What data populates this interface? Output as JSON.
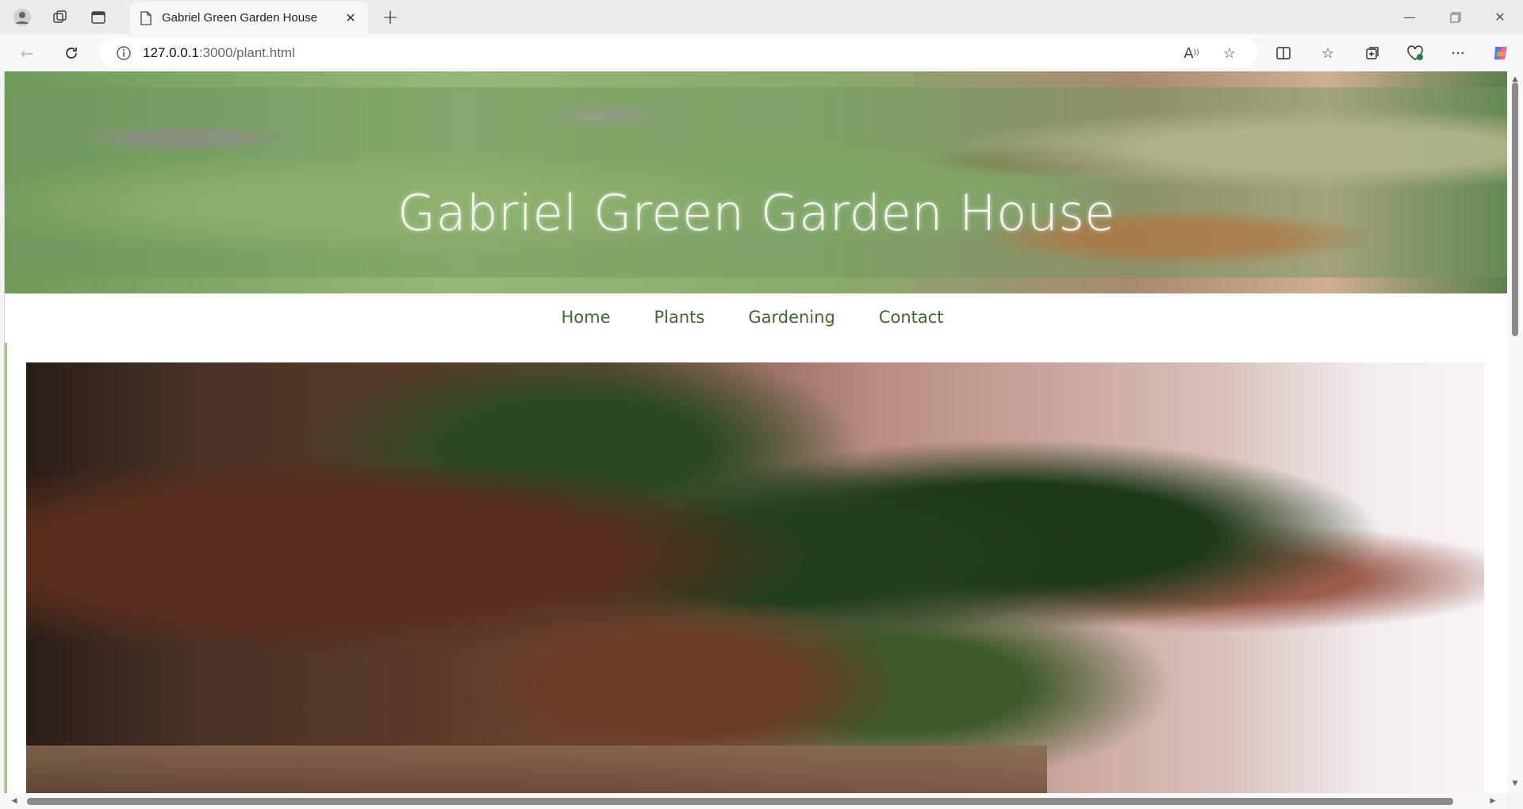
{
  "browser": {
    "tab_title": "Gabriel Green Garden House",
    "url_host": "127.0.0.1",
    "url_path": ":3000/plant.html"
  },
  "site": {
    "title": "Gabriel Green Garden House",
    "nav": [
      "Home",
      "Plants",
      "Gardening",
      "Contact"
    ]
  },
  "colors": {
    "nav_link": "#3f6b2a",
    "hero_overlay": "#6e965f"
  }
}
